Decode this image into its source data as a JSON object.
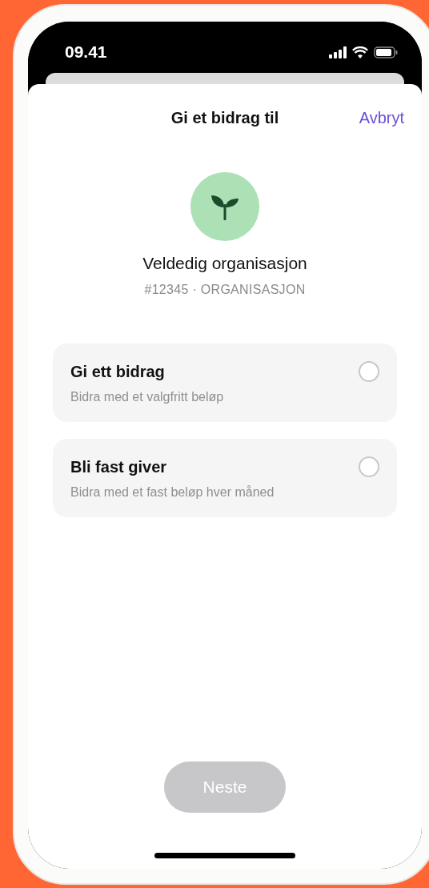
{
  "status_bar": {
    "time": "09.41"
  },
  "header": {
    "title": "Gi et bidrag til",
    "cancel": "Avbryt"
  },
  "organization": {
    "name": "Veldedig organisasjon",
    "meta": "#12345 · ORGANISASJON"
  },
  "options": [
    {
      "title": "Gi ett bidrag",
      "subtitle": "Bidra med et valgfritt beløp",
      "selected": false
    },
    {
      "title": "Bli fast giver",
      "subtitle": "Bidra med et fast beløp hver måned",
      "selected": false
    }
  ],
  "next_button": {
    "label": "Neste",
    "disabled": true
  }
}
